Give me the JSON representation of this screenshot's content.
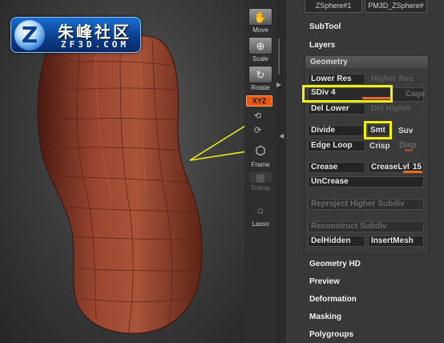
{
  "logo": {
    "emblem": "Z",
    "title": "朱峰社区",
    "subtitle": "ZF3D.COM"
  },
  "toolstrip": {
    "move": {
      "label": "Move",
      "icon": "hand-icon"
    },
    "scale": {
      "label": "Scale",
      "icon": "scale-icon"
    },
    "rotate": {
      "label": "Rotate",
      "icon": "rotate-icon"
    },
    "xyz": {
      "label": "XYZ"
    },
    "frame": {
      "label": "Frame",
      "icon": "cube-icon"
    },
    "transp": {
      "label": "Transp"
    },
    "lasso": {
      "label": "Lasso",
      "icon": "lasso-icon"
    }
  },
  "subtool_thumbs": [
    "ZSphere#1",
    "PM3D_ZSphere#"
  ],
  "menus": {
    "subtool": "SubTool",
    "layers": "Layers",
    "geometry_hd": "Geometry HD",
    "preview": "Preview",
    "deformation": "Deformation",
    "masking": "Masking",
    "polygroups": "Polygroups"
  },
  "geometry": {
    "title": "Geometry",
    "lower_res": "Lower Res",
    "higher_res": "Higher Res",
    "sdiv": "SDiv 4",
    "cage": "Cage",
    "del_lower": "Del Lower",
    "del_higher": "Del Higher",
    "divide": "Divide",
    "smt": "Smt",
    "suv": "Suv",
    "edge_loop": "Edge Loop",
    "crisp": "Crisp",
    "disp": "Disp",
    "crease": "Crease",
    "crease_lvl": "CreaseLvl",
    "crease_lvl_value": "15",
    "uncrease": "UnCrease",
    "reproject": "Reproject Higher Subdiv",
    "reconstruct": "Reconstruct Subdiv",
    "del_hidden": "DelHidden",
    "insert_mesh": "InsertMesh"
  },
  "colors": {
    "accent": "#e86a1c",
    "highlight": "#f0f016",
    "model": "#8a3a26"
  }
}
